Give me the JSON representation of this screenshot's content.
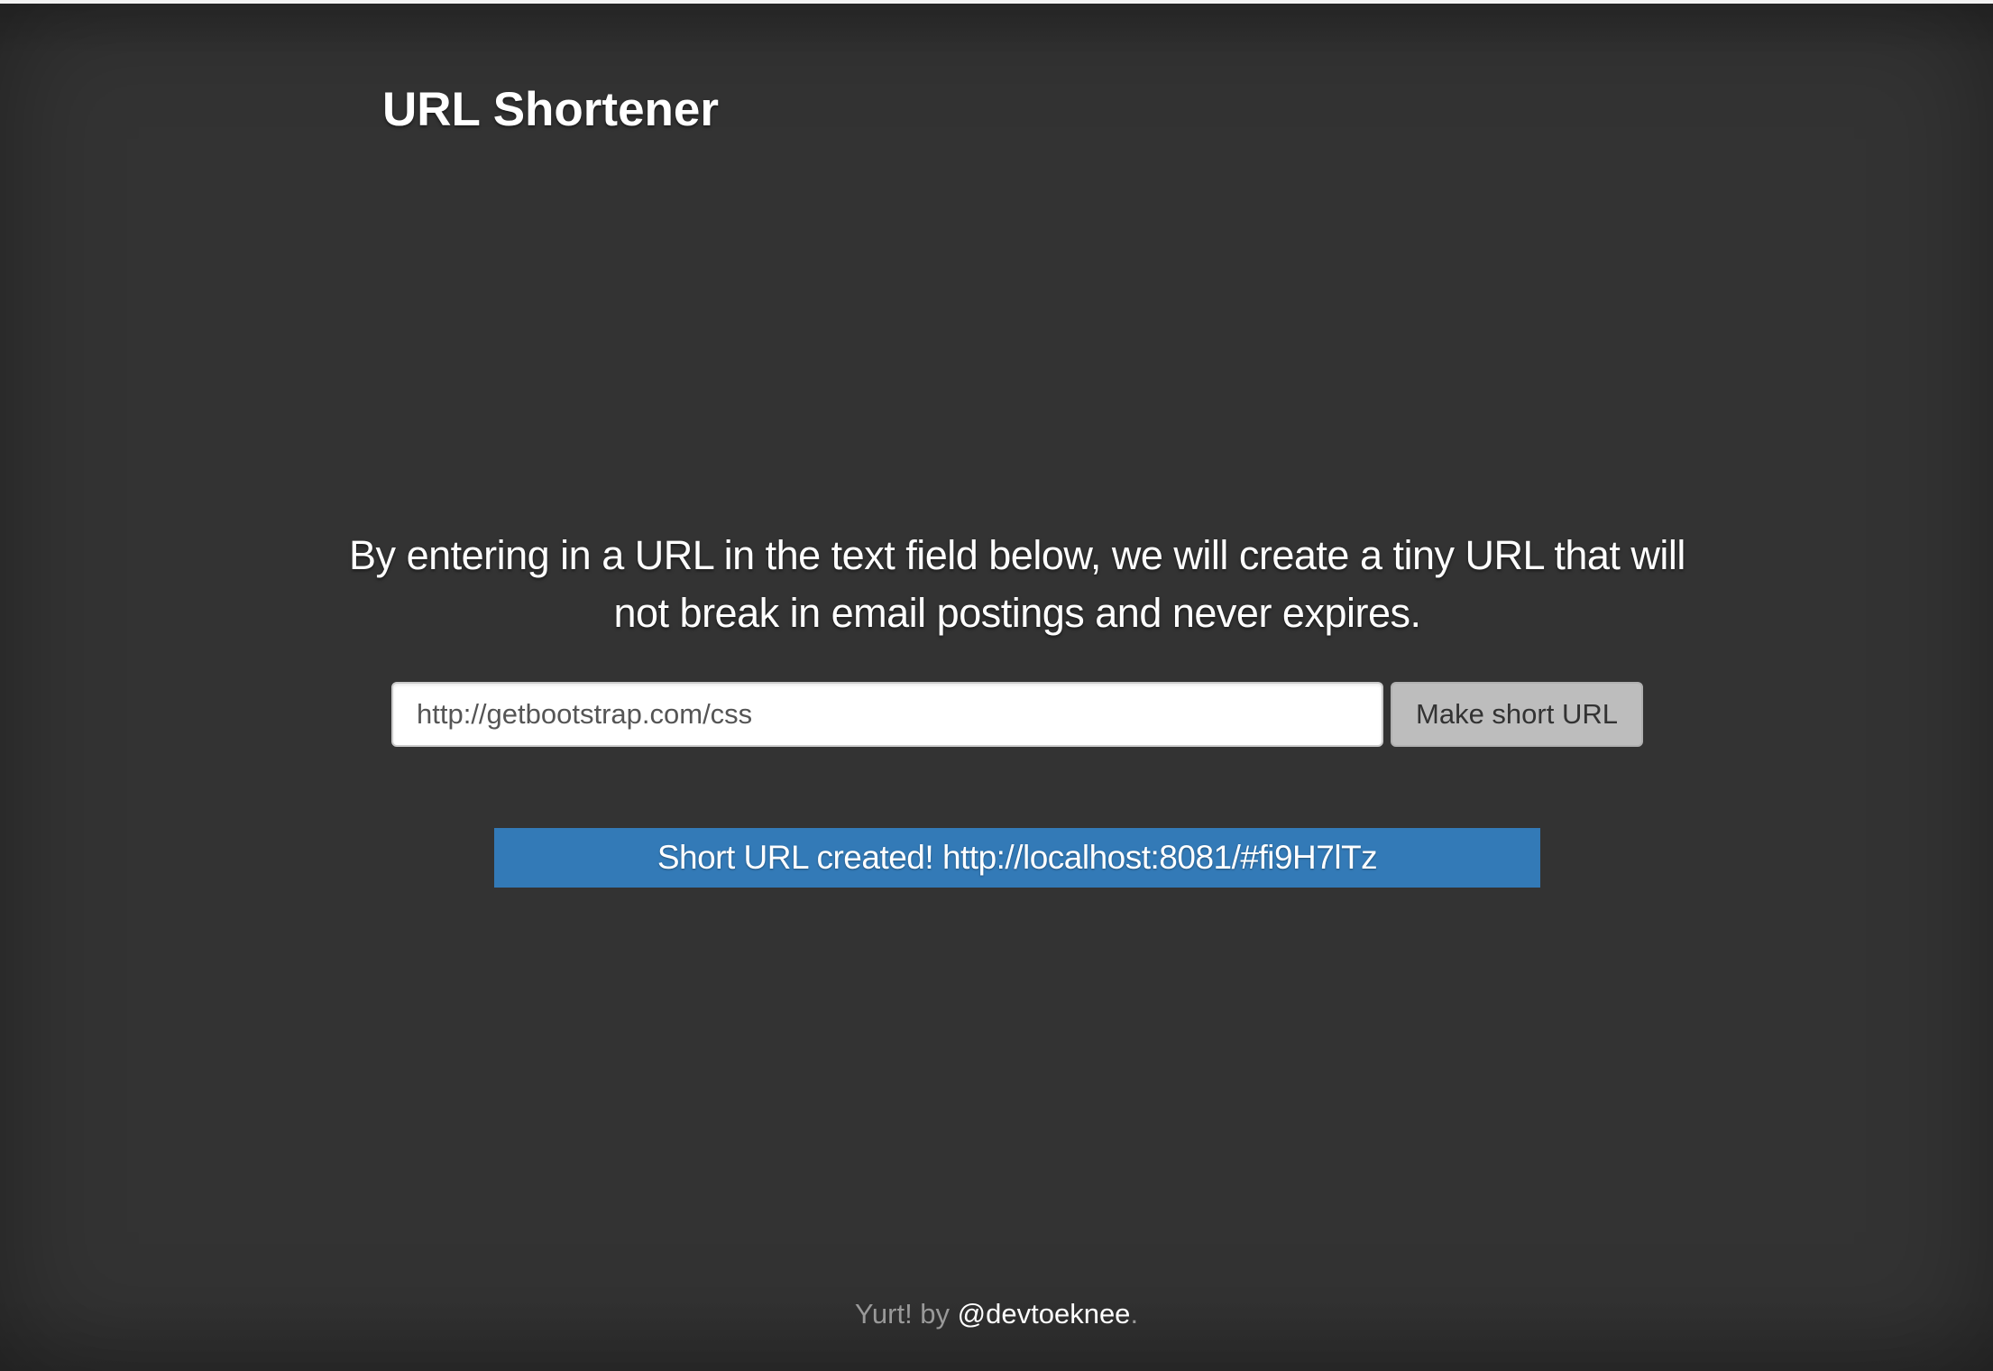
{
  "header": {
    "title": "URL Shortener"
  },
  "main": {
    "lead": "By entering in a URL in the text field below, we will create a tiny URL that will not break in email postings and never expires.",
    "url_input": {
      "value": "http://getbootstrap.com/css"
    },
    "submit_label": "Make short URL",
    "alert": "Short URL created! http://localhost:8081/#fi9H7lTz"
  },
  "footer": {
    "prefix": "Yurt! by ",
    "author": "@devtoeknee",
    "suffix": "."
  },
  "colors": {
    "background": "#333333",
    "alert_background": "#337ab7",
    "button_background": "#bdbdbd",
    "footer_text": "#999999"
  }
}
